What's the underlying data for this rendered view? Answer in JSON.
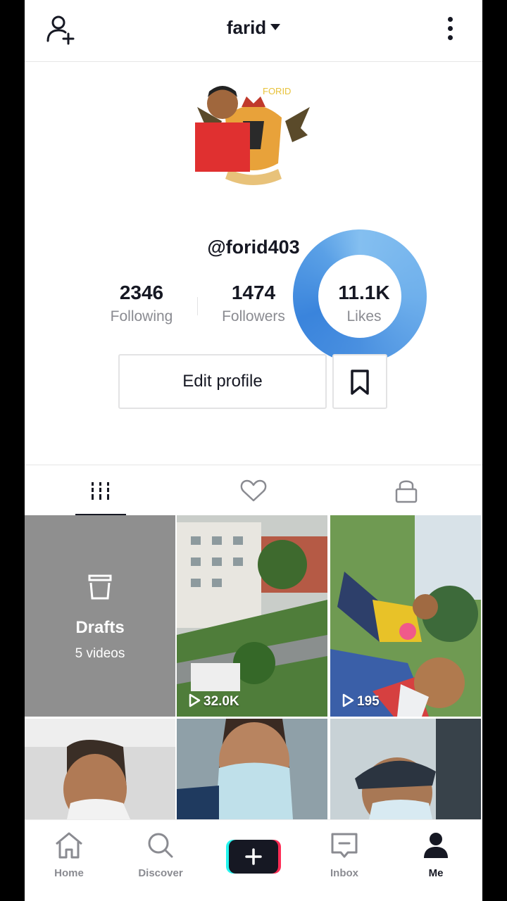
{
  "header": {
    "title": "farid"
  },
  "profile": {
    "handle": "@forid403",
    "stats": [
      {
        "value": "2346",
        "label": "Following"
      },
      {
        "value": "1474",
        "label": "Followers"
      },
      {
        "value": "11.1K",
        "label": "Likes"
      }
    ],
    "edit_label": "Edit profile"
  },
  "drafts": {
    "title": "Drafts",
    "count": "5 videos"
  },
  "videos": [
    {
      "views": "32.0K"
    },
    {
      "views": "195"
    }
  ],
  "nav": {
    "home": "Home",
    "discover": "Discover",
    "inbox": "Inbox",
    "me": "Me"
  },
  "colors": {
    "accent_ring": "#4a90e0",
    "brand_cyan": "#25f4ee",
    "brand_red": "#fe2c55"
  }
}
